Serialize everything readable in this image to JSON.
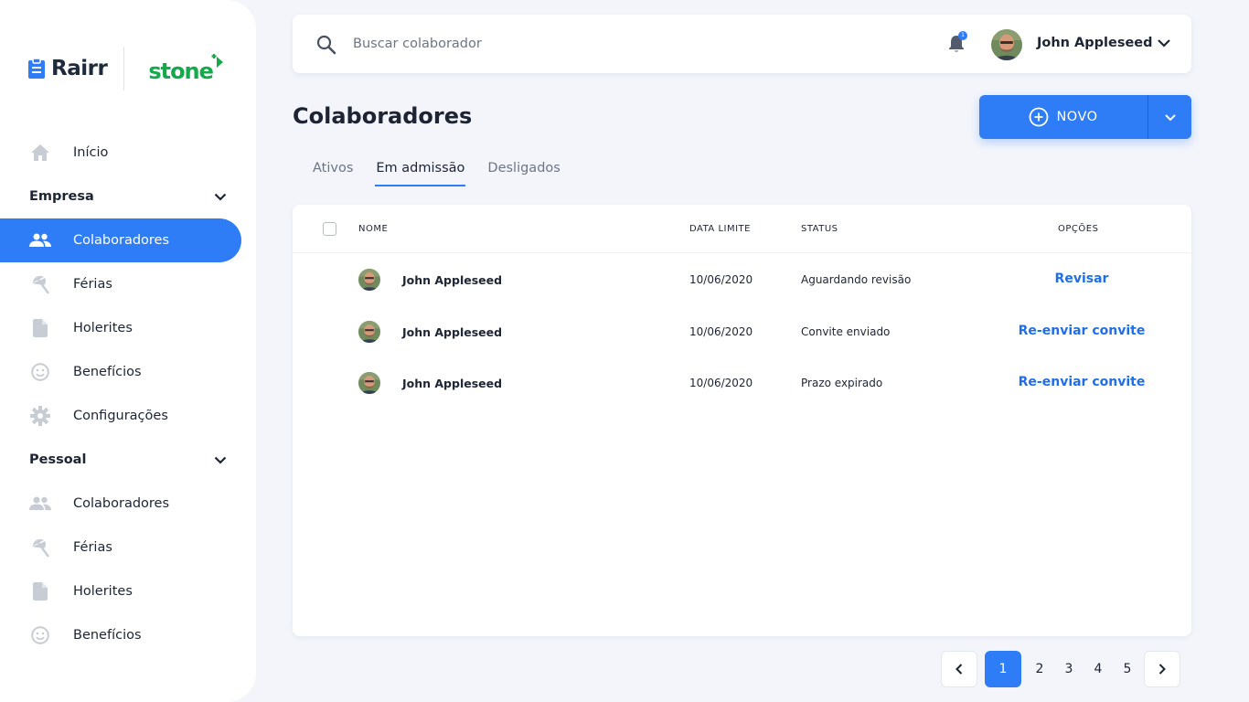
{
  "brand": {
    "name": "Rairr",
    "partner": "stone"
  },
  "colors": {
    "accent": "#2e7cf6",
    "link": "#1f6fe8",
    "stone_green": "#14aa4b",
    "icon_gray": "#c8ccd4"
  },
  "sidebar": {
    "items_top": [
      {
        "label": "Início",
        "icon": "home-icon"
      }
    ],
    "sections": [
      {
        "title": "Empresa",
        "items": [
          {
            "label": "Colaboradores",
            "icon": "people-icon",
            "active": true
          },
          {
            "label": "Férias",
            "icon": "beach-umbrella-icon"
          },
          {
            "label": "Holerites",
            "icon": "document-icon"
          },
          {
            "label": "Benefícios",
            "icon": "smiley-icon"
          },
          {
            "label": "Configurações",
            "icon": "gear-icon"
          }
        ]
      },
      {
        "title": "Pessoal",
        "items": [
          {
            "label": "Colaboradores",
            "icon": "people-icon"
          },
          {
            "label": "Férias",
            "icon": "beach-umbrella-icon"
          },
          {
            "label": "Holerites",
            "icon": "document-icon"
          },
          {
            "label": "Benefícios",
            "icon": "smiley-icon"
          }
        ]
      }
    ]
  },
  "topbar": {
    "search_placeholder": "Buscar colaborador",
    "notification_count": "1",
    "user_name": "John Appleseed"
  },
  "page": {
    "title": "Colaboradores",
    "new_button": "NOVO",
    "tabs": [
      {
        "label": "Ativos",
        "active": false
      },
      {
        "label": "Em admissão",
        "active": true
      },
      {
        "label": "Desligados",
        "active": false
      }
    ]
  },
  "table": {
    "columns": {
      "name": "NOME",
      "deadline": "DATA LIMITE",
      "status": "STATUS",
      "options": "OPÇÕES"
    },
    "rows": [
      {
        "name": "John Appleseed",
        "deadline": "10/06/2020",
        "status": "Aguardando revisão",
        "action": "Revisar"
      },
      {
        "name": "John Appleseed",
        "deadline": "10/06/2020",
        "status": "Convite enviado",
        "action": "Re-enviar convite"
      },
      {
        "name": "John Appleseed",
        "deadline": "10/06/2020",
        "status": "Prazo expirado",
        "action": "Re-enviar convite"
      }
    ]
  },
  "pagination": {
    "pages": [
      "1",
      "2",
      "3",
      "4",
      "5"
    ],
    "current": "1"
  }
}
